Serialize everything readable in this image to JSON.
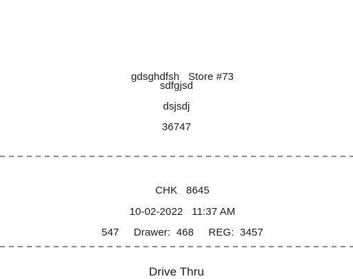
{
  "header": {
    "name": "gdsghdfsh",
    "store": "Store #73",
    "line2": "sdfgjsd",
    "line3": "dsjsdj",
    "line4": "36747"
  },
  "check": {
    "label": "CHK",
    "number": "8645",
    "date": "10-02-2022",
    "time": "11:37 AM",
    "id": "547",
    "drawer_label": "Drawer:",
    "drawer": "468",
    "reg_label": "REG:",
    "reg": "3457"
  },
  "order": {
    "type": "Drive Thru"
  },
  "colors": {
    "text": "#1a1a1a",
    "divider": "#444444",
    "background": "#ffffff"
  }
}
